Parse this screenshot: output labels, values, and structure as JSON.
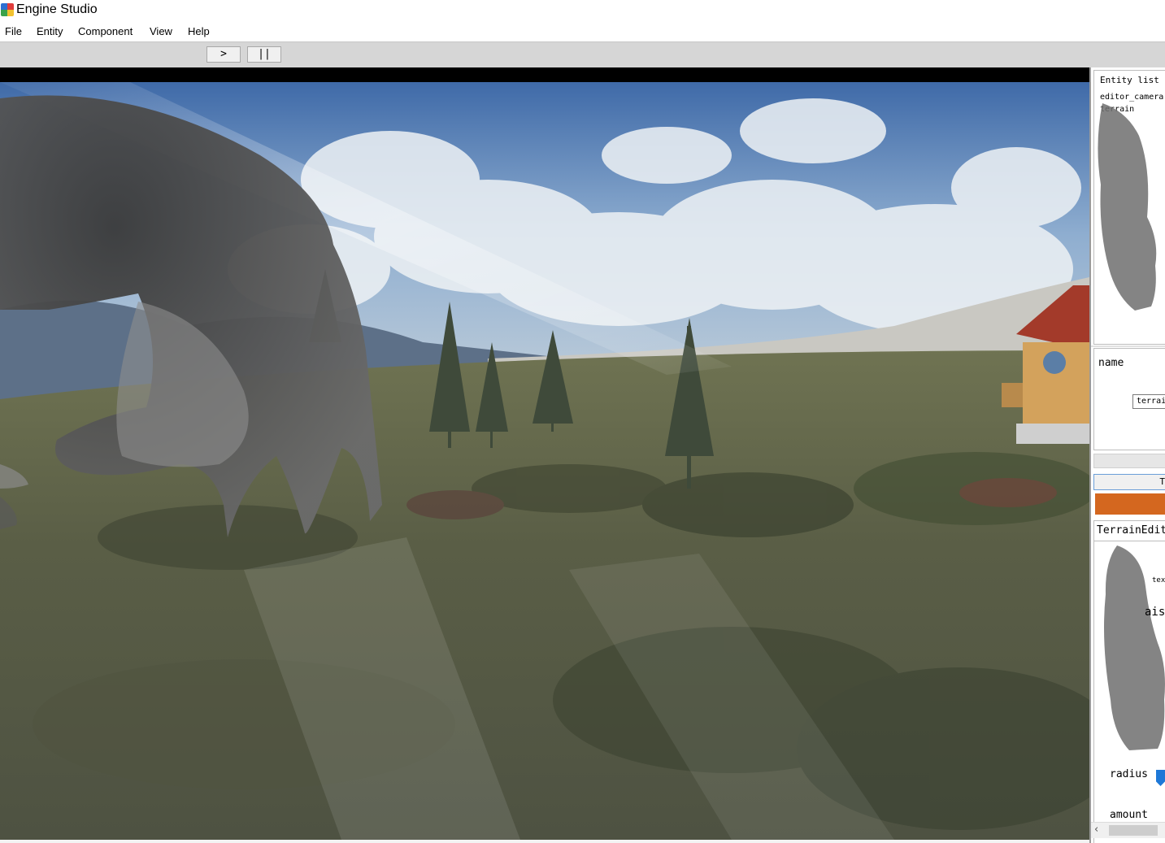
{
  "window": {
    "title": "Engine Studio"
  },
  "menu": {
    "items": [
      "File",
      "Entity",
      "Component",
      "View",
      "Help"
    ]
  },
  "toolbar": {
    "play_label": ">",
    "pause_label": "||"
  },
  "entity_list": {
    "title": "Entity list",
    "items": [
      "editor_camera",
      "terrain"
    ]
  },
  "properties": {
    "name_label": "name",
    "name_value": "terrain"
  },
  "component_tab": {
    "label": "T"
  },
  "terrain_editor": {
    "title": "TerrainEdit",
    "raise_label": "aise",
    "tex_label": "tex",
    "radius_label": "radius",
    "amount_label": "amount"
  },
  "colors": {
    "accent_orange": "#d4671f",
    "slider_blue": "#1e78d7",
    "toolbar_bg": "#d6d6d6"
  },
  "icons": {
    "app": "app-icon",
    "scroll_left": "chevron-left-icon"
  }
}
